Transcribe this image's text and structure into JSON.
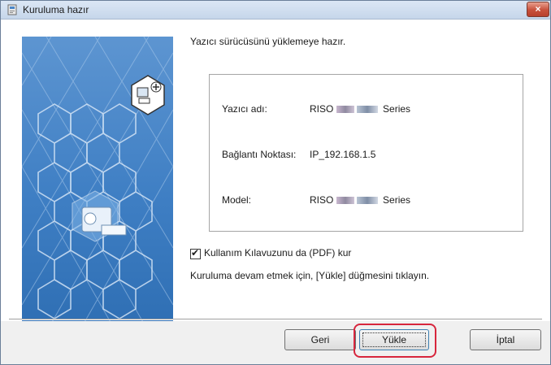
{
  "window": {
    "title": "Kuruluma hazır",
    "close_glyph": "×"
  },
  "heading": "Yazıcı sürücüsünü yüklemeye hazır.",
  "info": {
    "printer_name_label": "Yazıcı adı:",
    "printer_name_prefix": "RISO",
    "printer_name_suffix": "Series",
    "port_label": "Bağlantı Noktası:",
    "port_value": "IP_192.168.1.5",
    "model_label": "Model:",
    "model_prefix": "RISO",
    "model_suffix": "Series"
  },
  "manual_checkbox": {
    "label": "Kullanım Kılavuzunu da (PDF) kur",
    "checked": true,
    "check_glyph": "✔"
  },
  "instruction": "Kuruluma devam etmek için, [Yükle] düğmesini tıklayın.",
  "buttons": {
    "back": "Geri",
    "install": "Yükle",
    "cancel": "İptal"
  },
  "colors": {
    "highlight": "#d7263d",
    "banner": "#4a86c8",
    "close_button": "#c7503b"
  },
  "icons": [
    "installer-app-icon",
    "computer-plus-icon",
    "printer-icon",
    "hexagon-pattern"
  ]
}
